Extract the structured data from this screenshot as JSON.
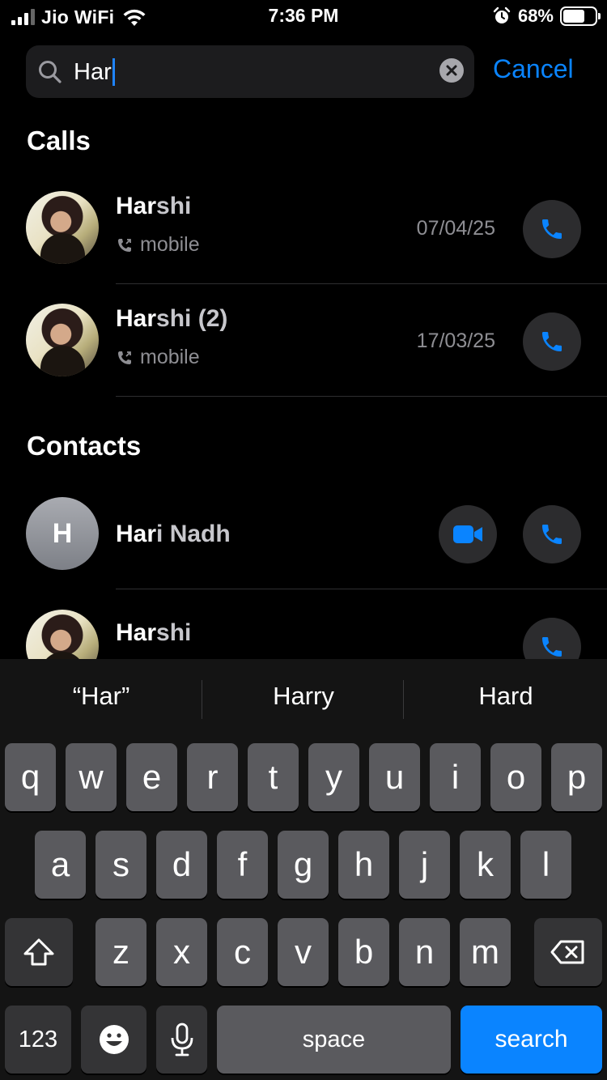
{
  "status_bar": {
    "carrier": "Jio WiFi",
    "time": "7:36 PM",
    "battery_percent": "68%",
    "battery_level": 0.68,
    "icons": [
      "signal-icon",
      "wifi-icon",
      "alarm-icon",
      "battery-icon"
    ]
  },
  "search": {
    "value": "Har",
    "cancel_label": "Cancel"
  },
  "calls": {
    "title": "Calls",
    "items": [
      {
        "name_match": "Har",
        "name_rest": "shi",
        "type": "mobile",
        "date": "07/04/25"
      },
      {
        "name_match": "Har",
        "name_rest": "shi (2)",
        "type": "mobile",
        "date": "17/03/25"
      }
    ]
  },
  "contacts": {
    "title": "Contacts",
    "items": [
      {
        "initial": "H",
        "name_match": "Har",
        "name_rest": "i Nadh"
      },
      {
        "name_match": "Har",
        "name_rest": "shi"
      }
    ]
  },
  "keyboard": {
    "suggestions": [
      "“Har”",
      "Harry",
      "Hard"
    ],
    "row1": [
      "q",
      "w",
      "e",
      "r",
      "t",
      "y",
      "u",
      "i",
      "o",
      "p"
    ],
    "row2": [
      "a",
      "s",
      "d",
      "f",
      "g",
      "h",
      "j",
      "k",
      "l"
    ],
    "row3": [
      "z",
      "x",
      "c",
      "v",
      "b",
      "n",
      "m"
    ],
    "numbers_label": "123",
    "space_label": "space",
    "search_label": "search"
  },
  "colors": {
    "accent": "#0a84ff",
    "background": "#000000",
    "key": "#5a5a5e"
  }
}
